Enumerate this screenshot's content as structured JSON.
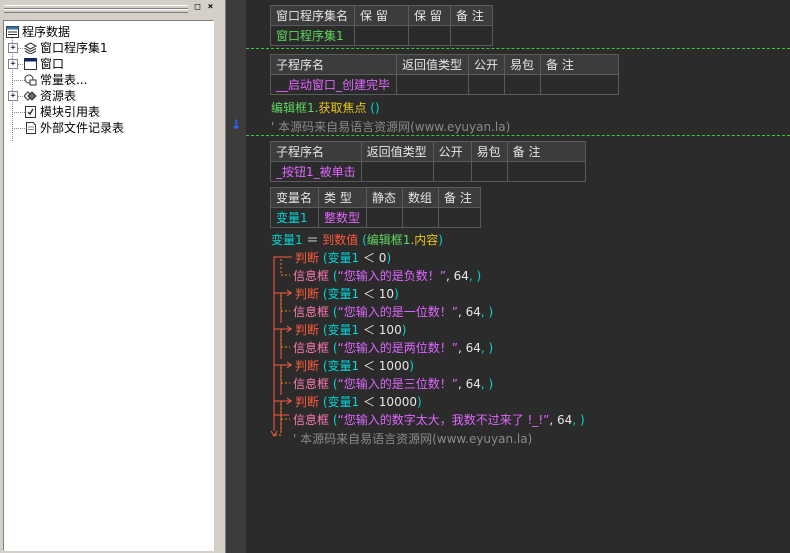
{
  "tree": {
    "title_buttons": {
      "maximize": "□",
      "close": "×"
    },
    "root": "程序数据",
    "items": [
      "窗口程序集1",
      "窗口",
      "常量表...",
      "资源表",
      "模块引用表",
      "外部文件记录表"
    ]
  },
  "editor": {
    "assembly_table": {
      "headers": [
        "窗口程序集名",
        "保 留",
        "保 留",
        "备 注"
      ],
      "row": [
        "窗口程序集1",
        "",
        "",
        ""
      ]
    },
    "sub1_table": {
      "headers": [
        "子程序名",
        "返回值类型",
        "公开",
        "易包",
        "备 注"
      ],
      "row": [
        "__启动窗口_创建完毕",
        "",
        "",
        "",
        ""
      ]
    },
    "sub1_code": {
      "obj": "编辑框1",
      "dot": ".",
      "method": "获取焦点",
      "parens": " ()",
      "comment": "' 本源码来自易语言资源网(www.eyuyan.la)"
    },
    "sub2_table": {
      "headers": [
        "子程序名",
        "返回值类型",
        "公开",
        "易包",
        "备 注"
      ],
      "row": [
        "_按钮1_被单击",
        "",
        "",
        "",
        ""
      ]
    },
    "var_table": {
      "headers": [
        "变量名",
        "类 型",
        "静态",
        "数组",
        "备 注"
      ],
      "row": [
        "变量1",
        "整数型",
        "",
        "",
        ""
      ]
    },
    "assign": {
      "var": "变量1",
      "eq": " ＝ ",
      "func": "到数值",
      "open": " (",
      "arg_obj": "编辑框1",
      "arg_prop": ".内容",
      "close": ")"
    },
    "judge_kw": "判断",
    "msg_kw": "信息框",
    "var_name": "变量1",
    "lt": " ＜ ",
    "branches": [
      {
        "num": "0",
        "msg": "“您输入的是负数！”",
        "arg": "64"
      },
      {
        "num": "10",
        "msg": "“您输入的是一位数！”",
        "arg": "64"
      },
      {
        "num": "100",
        "msg": "“您输入的是两位数！”",
        "arg": "64"
      },
      {
        "num": "1000",
        "msg": "“您输入的是三位数！”",
        "arg": "64"
      },
      {
        "num": "10000",
        "msg": "“您输入的数字太大，我数不过来了 !_!”",
        "arg": "64"
      }
    ],
    "end_comment": "' 本源码来自易语言资源网(www.eyuyan.la)"
  },
  "colors": {
    "editor_bg": "#2b2b2b",
    "header_bg": "#3c3c3c",
    "keyword_cyan": "#00d7d7",
    "flow_red": "#ff5a3c",
    "string_magenta": "#e066ff",
    "separator_green": "#3ec43e",
    "bookmark_blue": "#1e6cff"
  }
}
